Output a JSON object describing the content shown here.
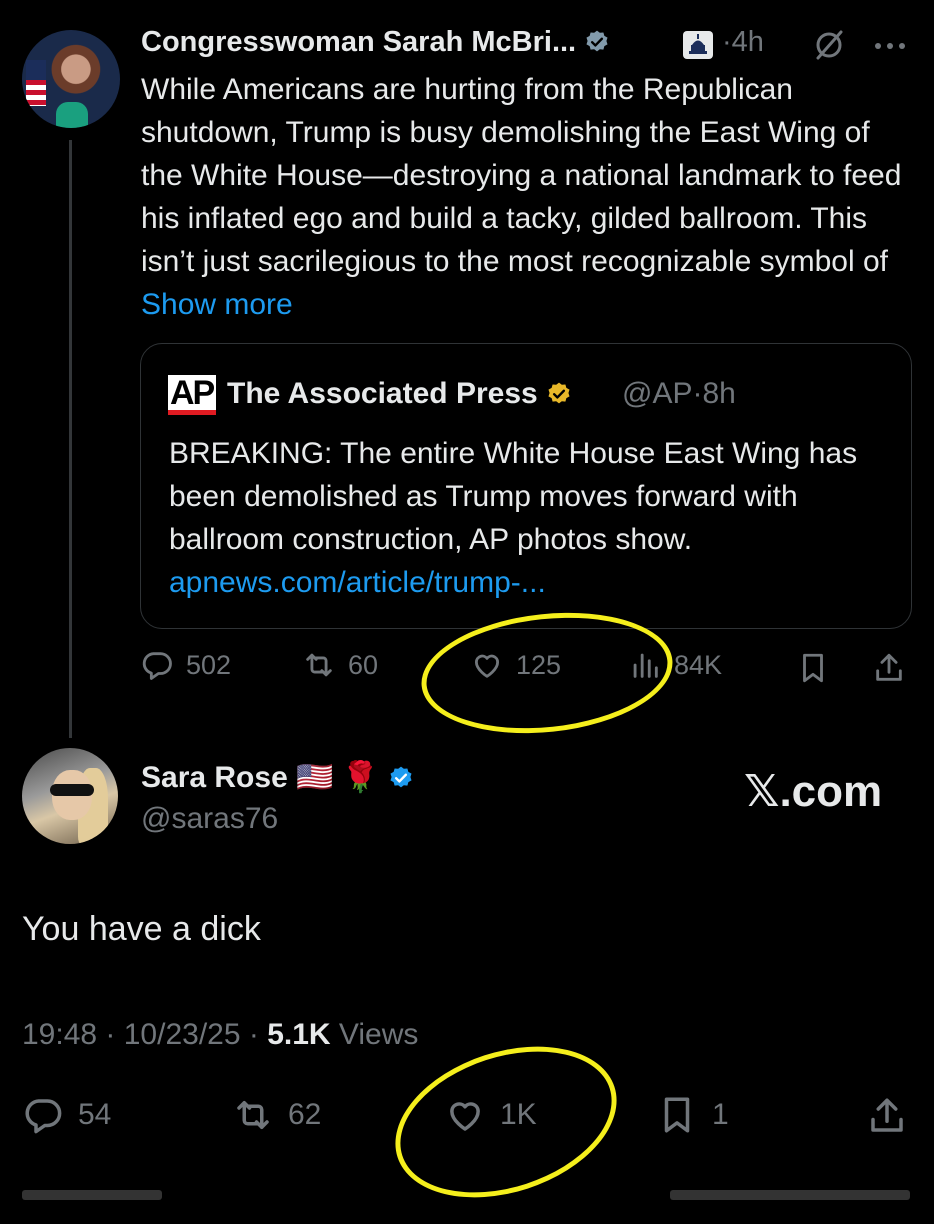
{
  "original_tweet": {
    "author_name": "Congresswoman Sarah McBri...",
    "separator": "·",
    "time_ago": "4h",
    "body": "While Americans are hurting from the Republican shutdown, Trump is busy demolishing the East Wing of the White House—destroying a national landmark to feed his inflated ego and build a tacky, gilded ballroom. This isn’t just sacrilegious to the most recognizable symbol of ",
    "show_more": "Show more",
    "quote": {
      "logo_text": "AP",
      "author_name": "The Associated Press",
      "handle": "@AP",
      "separator": "·",
      "time_ago": "8h",
      "body": "BREAKING: The entire White House East Wing has been demolished as Trump moves forward with ballroom construction, AP photos show. ",
      "link": "apnews.com/article/trump-..."
    },
    "actions": {
      "replies": "502",
      "reposts": "60",
      "likes": "125",
      "views": "84K"
    }
  },
  "reply_tweet": {
    "author_name": "Sara Rose",
    "emoji_flag": "🇺🇸",
    "emoji_rose": "🌹",
    "handle": "@saras76",
    "watermark": "𝕏.com",
    "body": "You have a dick",
    "time": "19:48",
    "date": "10/23/25",
    "views_count": "5.1K",
    "views_label": "Views",
    "actions": {
      "replies": "54",
      "reposts": "62",
      "likes": "1K",
      "bookmarks": "1"
    }
  },
  "colors": {
    "background": "#000000",
    "text": "#e7e9ea",
    "muted": "#71767b",
    "link": "#1d9bf0",
    "highlight_circle": "#f5ef1c",
    "verified_blue": "#1d9bf0",
    "verified_gold": "#e8b829"
  }
}
